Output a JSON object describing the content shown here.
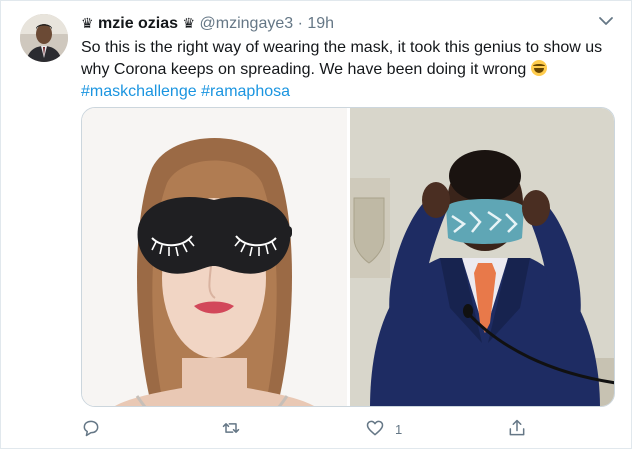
{
  "tweet": {
    "display_name": "mzie ozias",
    "handle": "@mzingaye3",
    "separator": "·",
    "time": "19h",
    "crown_left": "♛",
    "crown_right": "♛",
    "text_line1": "So this is the right way of wearing the mask, it took this genius to show us",
    "text_line2": "why Corona keeps on spreading. We have been doing it wrong",
    "hashtags": [
      "#maskchallenge",
      "#ramaphosa"
    ]
  },
  "actions": {
    "reply_count": "",
    "retweet_count": "",
    "like_count": "1"
  },
  "icons": {
    "more": "chevron-down-icon",
    "reply": "reply-icon",
    "retweet": "retweet-icon",
    "like": "heart-icon",
    "share": "share-icon"
  },
  "colors": {
    "text": "#14171a",
    "secondary": "#657786",
    "link": "#1b95e0",
    "border": "#e1e8ed"
  }
}
